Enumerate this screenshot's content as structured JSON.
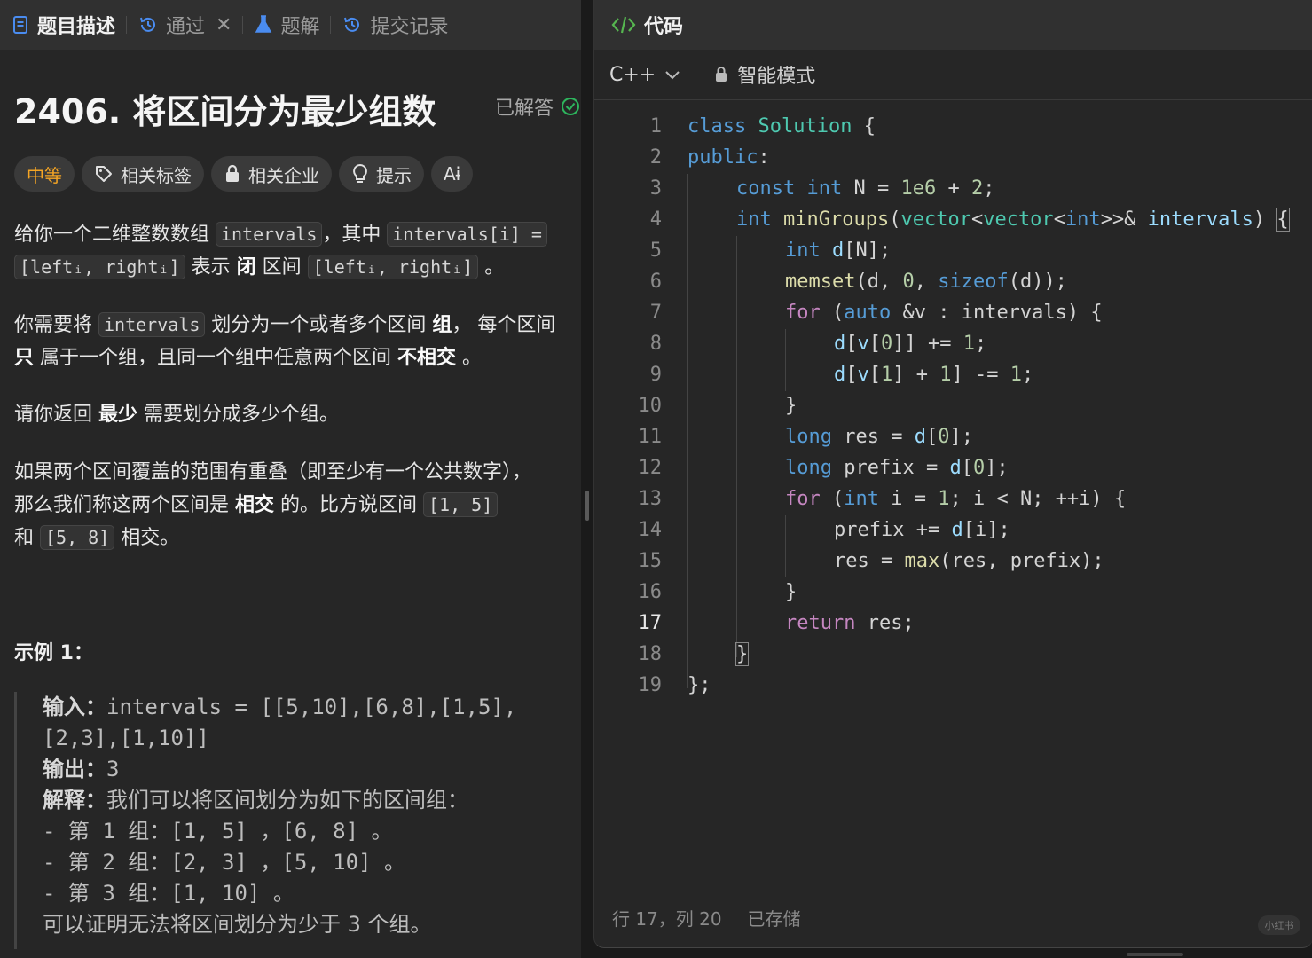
{
  "tabs": {
    "description": "题目描述",
    "status": "通过",
    "solutions": "题解",
    "submissions": "提交记录"
  },
  "problem": {
    "title": "2406. 将区间分为最少组数",
    "solved_label": "已解答"
  },
  "tags": {
    "difficulty": "中等",
    "related_tags": "相关标签",
    "related_companies": "相关企业",
    "hint": "提示",
    "font_toggle": "Aɨ"
  },
  "desc": {
    "p1_a": "给你一个二维整数数组 ",
    "p1_code1": "intervals",
    "p1_b": "，其中 ",
    "p1_code2": "intervals[i] =",
    "p1_code3": "[leftᵢ, rightᵢ]",
    "p1_c": " 表示 ",
    "p1_bold": "闭",
    "p1_d": " 区间 ",
    "p1_code4": "[leftᵢ, rightᵢ]",
    "p1_e": " 。",
    "p2_a": "你需要将 ",
    "p2_code": "intervals",
    "p2_b": " 划分为一个或者多个区间 ",
    "p2_bold1": "组",
    "p2_c": "， 每个区间",
    "p2_bold2": "只",
    "p2_d": " 属于一个组，且同一个组中任意两个区间 ",
    "p2_bold3": "不相交",
    "p2_e": " 。",
    "p3_a": "请你返回 ",
    "p3_bold": "最少",
    "p3_b": " 需要划分成多少个组。",
    "p4_line1": "如果两个区间覆盖的范围有重叠（即至少有一个公共数字），",
    "p4_a": "那么我们称这两个区间是 ",
    "p4_bold": "相交",
    "p4_b": " 的。比方说区间 ",
    "p4_code1": "[1, 5]",
    "p4_c": "和 ",
    "p4_code2": "[5, 8]",
    "p4_d": " 相交。"
  },
  "example": {
    "title": "示例 1：",
    "input_label": "输入：",
    "input_l1": "intervals = [[5,10],[6,8],[1,5],",
    "input_l2": "[2,3],[1,10]]",
    "output_label": "输出：",
    "output_value": "3",
    "explain_label": "解释：",
    "explain_text": "我们可以将区间划分为如下的区间组：",
    "group1": "- 第 1 组：[1, 5] ，[6, 8] 。",
    "group2": "- 第 2 组：[2, 3] ，[5, 10] 。",
    "group3": "- 第 3 组：[1, 10] 。",
    "conclusion": "可以证明无法将区间划分为少于 3 个组。"
  },
  "editor": {
    "header": "代码",
    "language": "C++",
    "mode": "智能模式",
    "current_line": 17
  },
  "status_bar": {
    "position": "行 17，列 20",
    "saved": "已存储"
  },
  "watermark": "小红书",
  "colors": {
    "keyword": "#569cd6",
    "control": "#c586c0",
    "type": "#4ec9b0",
    "function": "#dcdcaa",
    "number": "#b5cea8",
    "accent_code_icon": "#56b650",
    "difficulty": "#f5a524"
  }
}
